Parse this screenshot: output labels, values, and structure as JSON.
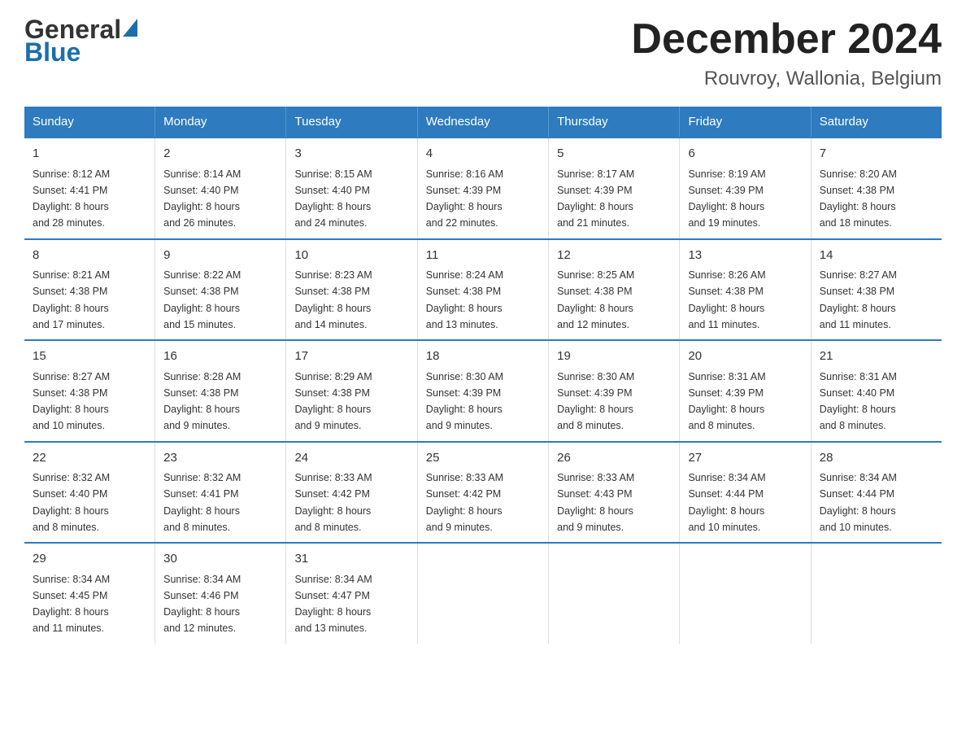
{
  "header": {
    "logo_general": "General",
    "logo_blue": "Blue",
    "main_title": "December 2024",
    "subtitle": "Rouvroy, Wallonia, Belgium"
  },
  "days_of_week": [
    "Sunday",
    "Monday",
    "Tuesday",
    "Wednesday",
    "Thursday",
    "Friday",
    "Saturday"
  ],
  "weeks": [
    [
      {
        "day": "1",
        "sunrise": "8:12 AM",
        "sunset": "4:41 PM",
        "daylight_hours": "8 hours",
        "daylight_minutes": "and 28 minutes."
      },
      {
        "day": "2",
        "sunrise": "8:14 AM",
        "sunset": "4:40 PM",
        "daylight_hours": "8 hours",
        "daylight_minutes": "and 26 minutes."
      },
      {
        "day": "3",
        "sunrise": "8:15 AM",
        "sunset": "4:40 PM",
        "daylight_hours": "8 hours",
        "daylight_minutes": "and 24 minutes."
      },
      {
        "day": "4",
        "sunrise": "8:16 AM",
        "sunset": "4:39 PM",
        "daylight_hours": "8 hours",
        "daylight_minutes": "and 22 minutes."
      },
      {
        "day": "5",
        "sunrise": "8:17 AM",
        "sunset": "4:39 PM",
        "daylight_hours": "8 hours",
        "daylight_minutes": "and 21 minutes."
      },
      {
        "day": "6",
        "sunrise": "8:19 AM",
        "sunset": "4:39 PM",
        "daylight_hours": "8 hours",
        "daylight_minutes": "and 19 minutes."
      },
      {
        "day": "7",
        "sunrise": "8:20 AM",
        "sunset": "4:38 PM",
        "daylight_hours": "8 hours",
        "daylight_minutes": "and 18 minutes."
      }
    ],
    [
      {
        "day": "8",
        "sunrise": "8:21 AM",
        "sunset": "4:38 PM",
        "daylight_hours": "8 hours",
        "daylight_minutes": "and 17 minutes."
      },
      {
        "day": "9",
        "sunrise": "8:22 AM",
        "sunset": "4:38 PM",
        "daylight_hours": "8 hours",
        "daylight_minutes": "and 15 minutes."
      },
      {
        "day": "10",
        "sunrise": "8:23 AM",
        "sunset": "4:38 PM",
        "daylight_hours": "8 hours",
        "daylight_minutes": "and 14 minutes."
      },
      {
        "day": "11",
        "sunrise": "8:24 AM",
        "sunset": "4:38 PM",
        "daylight_hours": "8 hours",
        "daylight_minutes": "and 13 minutes."
      },
      {
        "day": "12",
        "sunrise": "8:25 AM",
        "sunset": "4:38 PM",
        "daylight_hours": "8 hours",
        "daylight_minutes": "and 12 minutes."
      },
      {
        "day": "13",
        "sunrise": "8:26 AM",
        "sunset": "4:38 PM",
        "daylight_hours": "8 hours",
        "daylight_minutes": "and 11 minutes."
      },
      {
        "day": "14",
        "sunrise": "8:27 AM",
        "sunset": "4:38 PM",
        "daylight_hours": "8 hours",
        "daylight_minutes": "and 11 minutes."
      }
    ],
    [
      {
        "day": "15",
        "sunrise": "8:27 AM",
        "sunset": "4:38 PM",
        "daylight_hours": "8 hours",
        "daylight_minutes": "and 10 minutes."
      },
      {
        "day": "16",
        "sunrise": "8:28 AM",
        "sunset": "4:38 PM",
        "daylight_hours": "8 hours",
        "daylight_minutes": "and 9 minutes."
      },
      {
        "day": "17",
        "sunrise": "8:29 AM",
        "sunset": "4:38 PM",
        "daylight_hours": "8 hours",
        "daylight_minutes": "and 9 minutes."
      },
      {
        "day": "18",
        "sunrise": "8:30 AM",
        "sunset": "4:39 PM",
        "daylight_hours": "8 hours",
        "daylight_minutes": "and 9 minutes."
      },
      {
        "day": "19",
        "sunrise": "8:30 AM",
        "sunset": "4:39 PM",
        "daylight_hours": "8 hours",
        "daylight_minutes": "and 8 minutes."
      },
      {
        "day": "20",
        "sunrise": "8:31 AM",
        "sunset": "4:39 PM",
        "daylight_hours": "8 hours",
        "daylight_minutes": "and 8 minutes."
      },
      {
        "day": "21",
        "sunrise": "8:31 AM",
        "sunset": "4:40 PM",
        "daylight_hours": "8 hours",
        "daylight_minutes": "and 8 minutes."
      }
    ],
    [
      {
        "day": "22",
        "sunrise": "8:32 AM",
        "sunset": "4:40 PM",
        "daylight_hours": "8 hours",
        "daylight_minutes": "and 8 minutes."
      },
      {
        "day": "23",
        "sunrise": "8:32 AM",
        "sunset": "4:41 PM",
        "daylight_hours": "8 hours",
        "daylight_minutes": "and 8 minutes."
      },
      {
        "day": "24",
        "sunrise": "8:33 AM",
        "sunset": "4:42 PM",
        "daylight_hours": "8 hours",
        "daylight_minutes": "and 8 minutes."
      },
      {
        "day": "25",
        "sunrise": "8:33 AM",
        "sunset": "4:42 PM",
        "daylight_hours": "8 hours",
        "daylight_minutes": "and 9 minutes."
      },
      {
        "day": "26",
        "sunrise": "8:33 AM",
        "sunset": "4:43 PM",
        "daylight_hours": "8 hours",
        "daylight_minutes": "and 9 minutes."
      },
      {
        "day": "27",
        "sunrise": "8:34 AM",
        "sunset": "4:44 PM",
        "daylight_hours": "8 hours",
        "daylight_minutes": "and 10 minutes."
      },
      {
        "day": "28",
        "sunrise": "8:34 AM",
        "sunset": "4:44 PM",
        "daylight_hours": "8 hours",
        "daylight_minutes": "and 10 minutes."
      }
    ],
    [
      {
        "day": "29",
        "sunrise": "8:34 AM",
        "sunset": "4:45 PM",
        "daylight_hours": "8 hours",
        "daylight_minutes": "and 11 minutes."
      },
      {
        "day": "30",
        "sunrise": "8:34 AM",
        "sunset": "4:46 PM",
        "daylight_hours": "8 hours",
        "daylight_minutes": "and 12 minutes."
      },
      {
        "day": "31",
        "sunrise": "8:34 AM",
        "sunset": "4:47 PM",
        "daylight_hours": "8 hours",
        "daylight_minutes": "and 13 minutes."
      },
      null,
      null,
      null,
      null
    ]
  ],
  "labels": {
    "sunrise_prefix": "Sunrise: ",
    "sunset_prefix": "Sunset: ",
    "daylight_prefix": "Daylight: "
  }
}
